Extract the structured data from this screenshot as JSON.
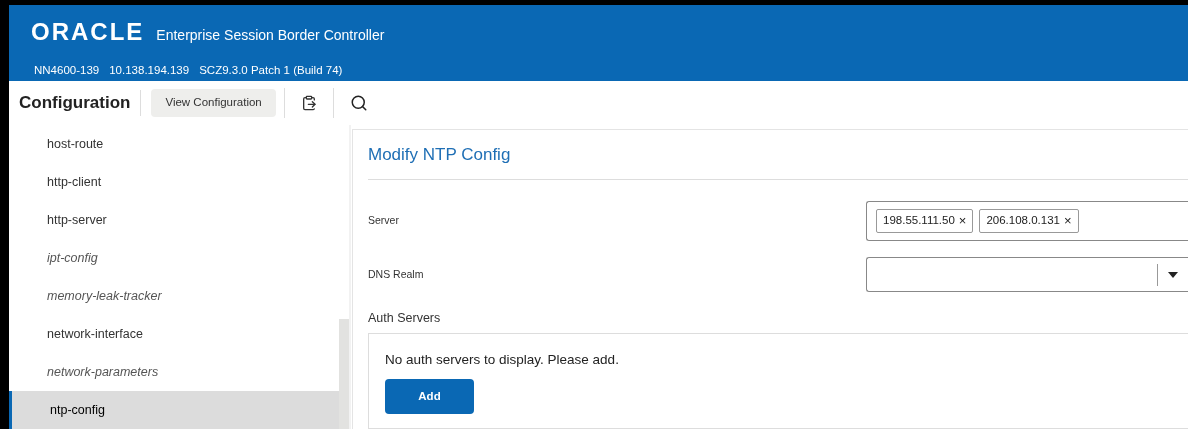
{
  "header": {
    "logo": "ORACLE",
    "product": "Enterprise Session Border Controller",
    "info": [
      "NN4600-139",
      "10.138.194.139",
      "SCZ9.3.0 Patch 1 (Build 74)"
    ]
  },
  "toolbar": {
    "title": "Configuration",
    "view_button": "View Configuration"
  },
  "sidebar": {
    "items": [
      {
        "label": "host-route",
        "italic": false,
        "selected": false
      },
      {
        "label": "http-client",
        "italic": false,
        "selected": false
      },
      {
        "label": "http-server",
        "italic": false,
        "selected": false
      },
      {
        "label": "ipt-config",
        "italic": true,
        "selected": false
      },
      {
        "label": "memory-leak-tracker",
        "italic": true,
        "selected": false
      },
      {
        "label": "network-interface",
        "italic": false,
        "selected": false
      },
      {
        "label": "network-parameters",
        "italic": true,
        "selected": false
      },
      {
        "label": "ntp-config",
        "italic": false,
        "selected": true
      }
    ]
  },
  "form": {
    "title": "Modify NTP Config",
    "server": {
      "label": "Server",
      "tags": [
        {
          "value": "198.55.111.50",
          "remove": "×"
        },
        {
          "value": "206.108.0.131",
          "remove": "×"
        }
      ]
    },
    "dns_realm": {
      "label": "DNS Realm"
    },
    "auth_servers": {
      "label": "Auth Servers",
      "empty": "No auth servers to display. Please add.",
      "add_button": "Add"
    }
  }
}
